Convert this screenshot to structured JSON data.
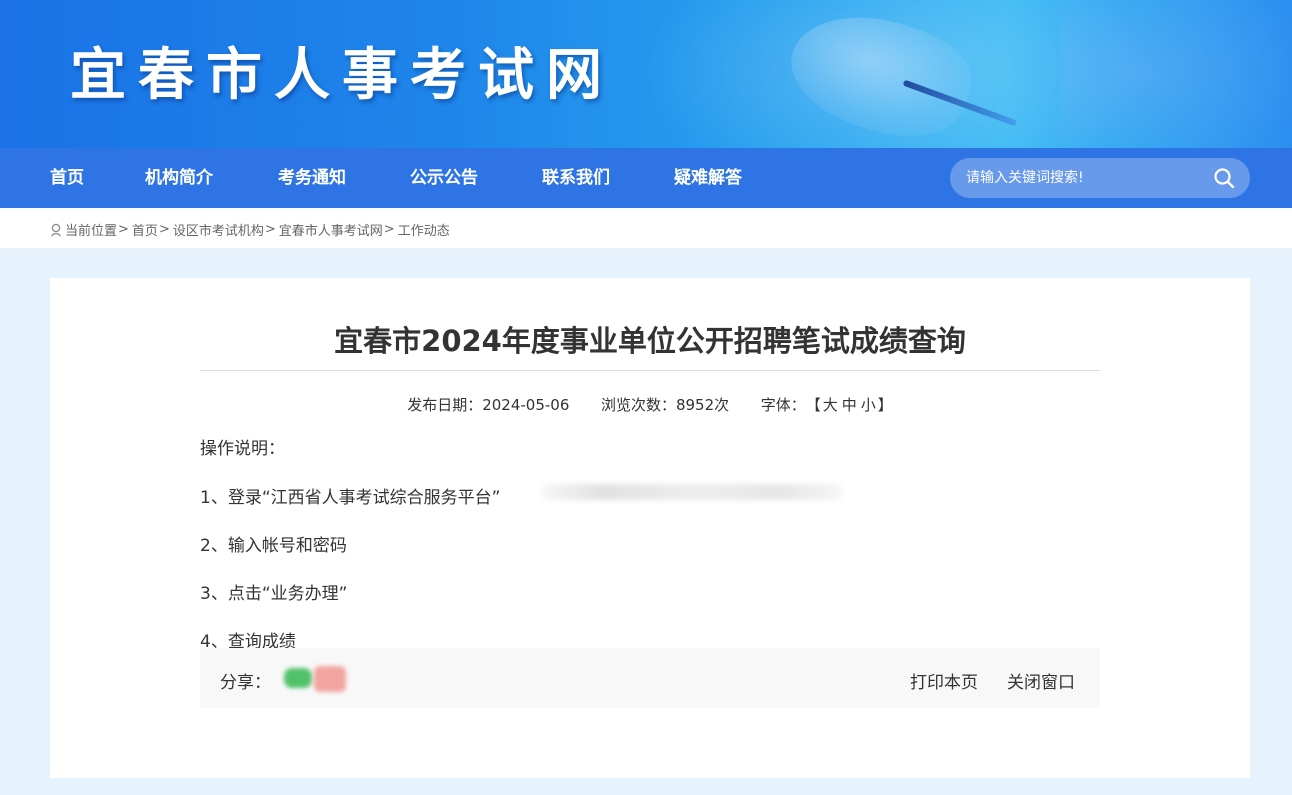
{
  "site": {
    "title": "宜春市人事考试网"
  },
  "nav": {
    "items": [
      {
        "label": "首页"
      },
      {
        "label": "机构简介"
      },
      {
        "label": "考务通知"
      },
      {
        "label": "公示公告"
      },
      {
        "label": "联系我们"
      },
      {
        "label": "疑难解答"
      }
    ],
    "search_placeholder": "请输入关键词搜索!",
    "search_icon": "search-icon"
  },
  "breadcrumb": {
    "prefix": "当前位置",
    "items": [
      {
        "label": "首页"
      },
      {
        "label": "设区市考试机构"
      },
      {
        "label": "宜春市人事考试网"
      },
      {
        "label": "工作动态"
      }
    ],
    "separator": ">"
  },
  "article": {
    "title": "宜春市2024年度事业单位公开招聘笔试成绩查询",
    "publish_label": "发布日期：",
    "publish_date": "2024-05-06",
    "views_label": "浏览次数：",
    "views_count": "8952次",
    "font_label": "字体：",
    "font_open": "【",
    "font_large": "大",
    "font_medium": "中",
    "font_small": "小",
    "font_close": "】",
    "body": {
      "intro": "操作说明：",
      "steps": [
        "1、登录“江西省人事考试综合服务平台”",
        "2、输入帐号和密码",
        "3、点击“业务办理”",
        "4、查询成绩"
      ]
    }
  },
  "share": {
    "label": "分享：",
    "print": "打印本页",
    "close": "关闭窗口"
  },
  "colors": {
    "nav_bg": "#2f74e4",
    "page_bg": "#e6f3fc",
    "share_bg": "#f8f8f8"
  }
}
